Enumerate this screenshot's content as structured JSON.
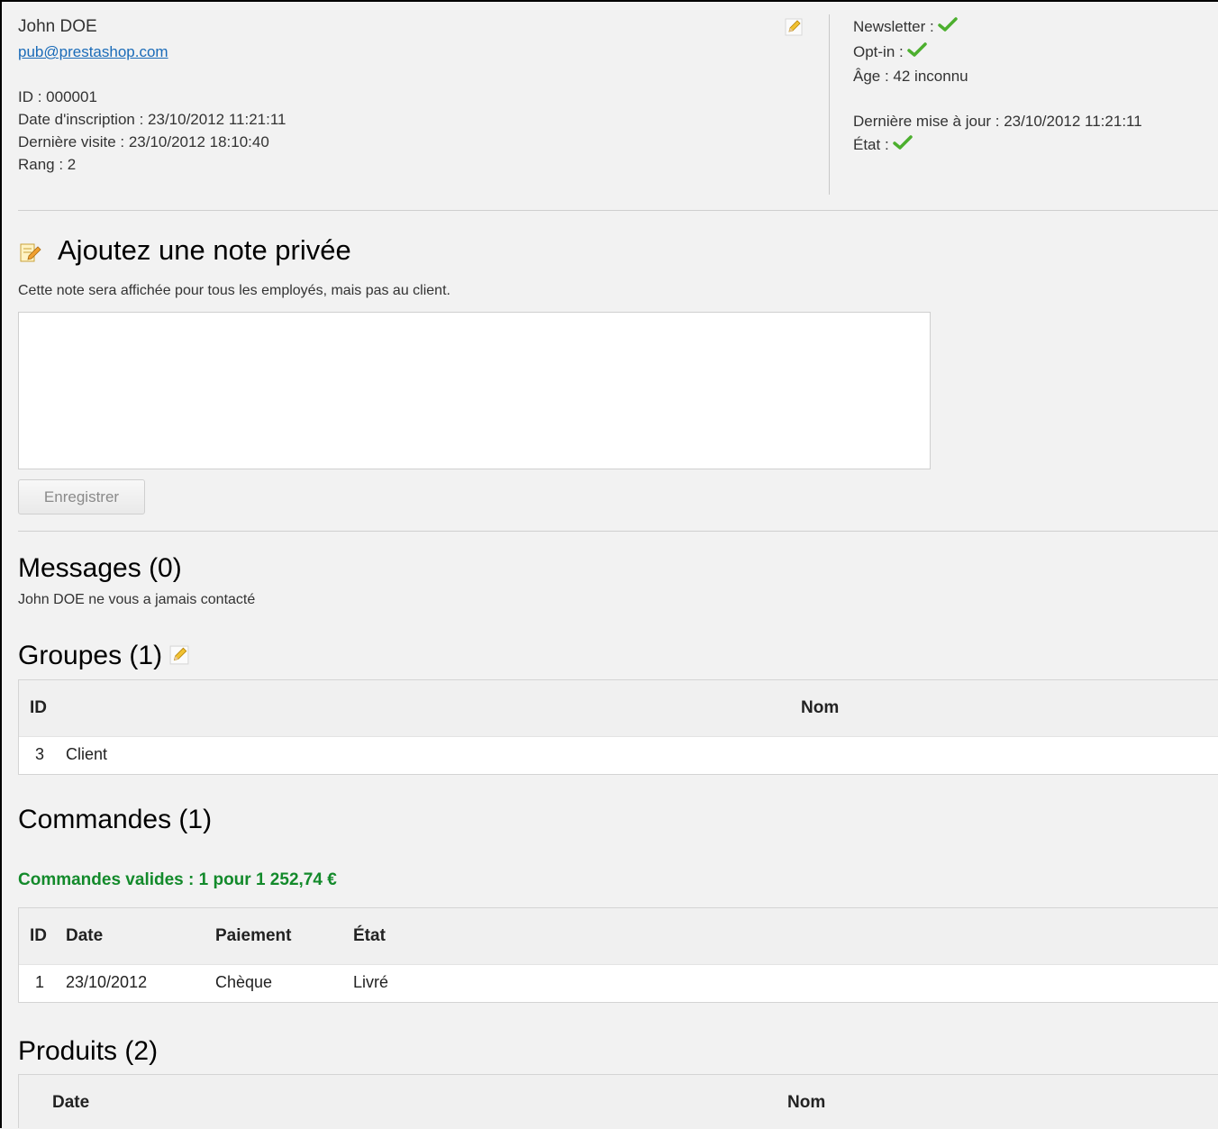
{
  "customer": {
    "name": "John DOE",
    "email": "pub@prestashop.com",
    "id_line": "ID : 000001",
    "registration_line": "Date d'inscription : 23/10/2012 11:21:11",
    "last_visit_line": "Dernière visite : 23/10/2012 18:10:40",
    "rank_line": "Rang : 2"
  },
  "status": {
    "newsletter_label": "Newsletter :",
    "optin_label": "Opt-in :",
    "age_line": "Âge : 42 inconnu",
    "last_update_line": "Dernière mise à jour : 23/10/2012 11:21:11",
    "state_label": "État :"
  },
  "note": {
    "title": "Ajoutez une note privée",
    "hint": "Cette note sera affichée pour tous les employés, mais pas au client.",
    "value": "",
    "save_label": "Enregistrer"
  },
  "messages": {
    "title": "Messages (0)",
    "empty_text": "John DOE ne vous a jamais contacté"
  },
  "groups": {
    "title": "Groupes (1)",
    "columns": [
      "ID",
      "Nom"
    ],
    "rows": [
      [
        "3",
        "Client"
      ]
    ]
  },
  "orders": {
    "title": "Commandes (1)",
    "valid_summary": "Commandes valides : 1 pour 1 252,74 €",
    "columns": [
      "ID",
      "Date",
      "Paiement",
      "État"
    ],
    "rows": [
      [
        "1",
        "23/10/2012",
        "Chèque",
        "Livré"
      ]
    ]
  },
  "products": {
    "title": "Produits (2)",
    "columns": [
      "Date",
      "Nom"
    ]
  },
  "colors": {
    "check_green": "#4caf2e",
    "valid_green": "#138a2b",
    "link_blue": "#1a6bb8"
  }
}
